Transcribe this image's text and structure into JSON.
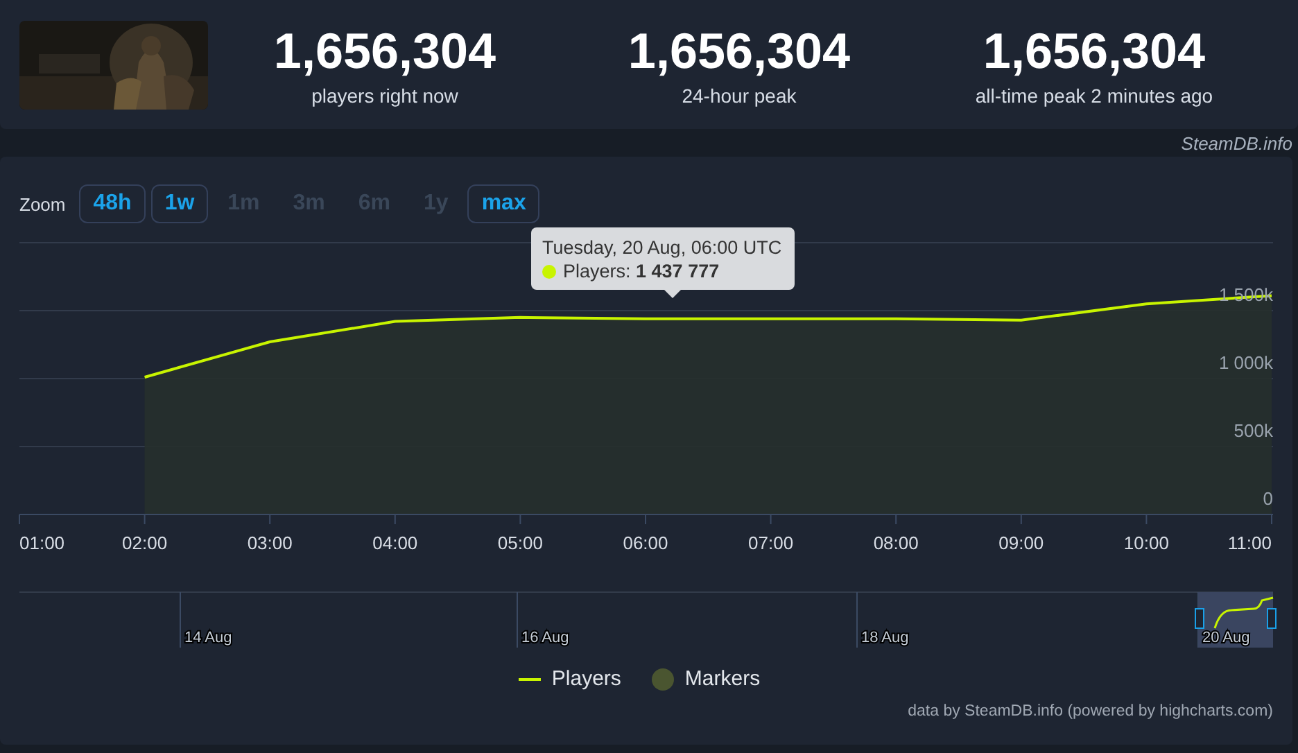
{
  "header": {
    "stats": [
      {
        "value": "1,656,304",
        "label": "players right now"
      },
      {
        "value": "1,656,304",
        "label": "24-hour peak"
      },
      {
        "value": "1,656,304",
        "label": "all-time peak 2 minutes ago"
      }
    ]
  },
  "source": "SteamDB.info",
  "zoom": {
    "label": "Zoom",
    "buttons": [
      {
        "label": "48h",
        "disabled": false
      },
      {
        "label": "1w",
        "disabled": false
      },
      {
        "label": "1m",
        "disabled": true
      },
      {
        "label": "3m",
        "disabled": true
      },
      {
        "label": "6m",
        "disabled": true
      },
      {
        "label": "1y",
        "disabled": true
      },
      {
        "label": "max",
        "disabled": false
      }
    ]
  },
  "chart": {
    "chart_data": {
      "type": "area",
      "categories": [
        "01:00",
        "02:00",
        "03:00",
        "04:00",
        "05:00",
        "06:00",
        "07:00",
        "08:00",
        "09:00",
        "10:00",
        "11:00"
      ],
      "series": [
        {
          "name": "Players",
          "color": "#c8f400",
          "values": [
            null,
            1010000,
            1270000,
            1420000,
            1450000,
            1440000,
            1440000,
            1440000,
            1430000,
            1550000,
            1610000
          ]
        }
      ],
      "grid": true,
      "ylim": [
        0,
        2000000
      ],
      "yticks": [
        {
          "value": 0,
          "label": "0"
        },
        {
          "value": 500000,
          "label": "500k"
        },
        {
          "value": 1000000,
          "label": "1 000k"
        },
        {
          "value": 1500000,
          "label": "1 500k"
        }
      ]
    },
    "tooltip": {
      "title": "Tuesday, 20 Aug, 06:00 UTC",
      "text": "Players: **1 437 777**"
    }
  },
  "navigator": {
    "labels": [
      "14 Aug",
      "16 Aug",
      "18 Aug",
      "20 Aug"
    ]
  },
  "legend": [
    {
      "kind": "series"
    },
    {
      "label": "Markers",
      "kind": "dot",
      "color": "#4a5530"
    }
  ],
  "credits": "data by SteamDB.info (powered by highcharts.com)"
}
